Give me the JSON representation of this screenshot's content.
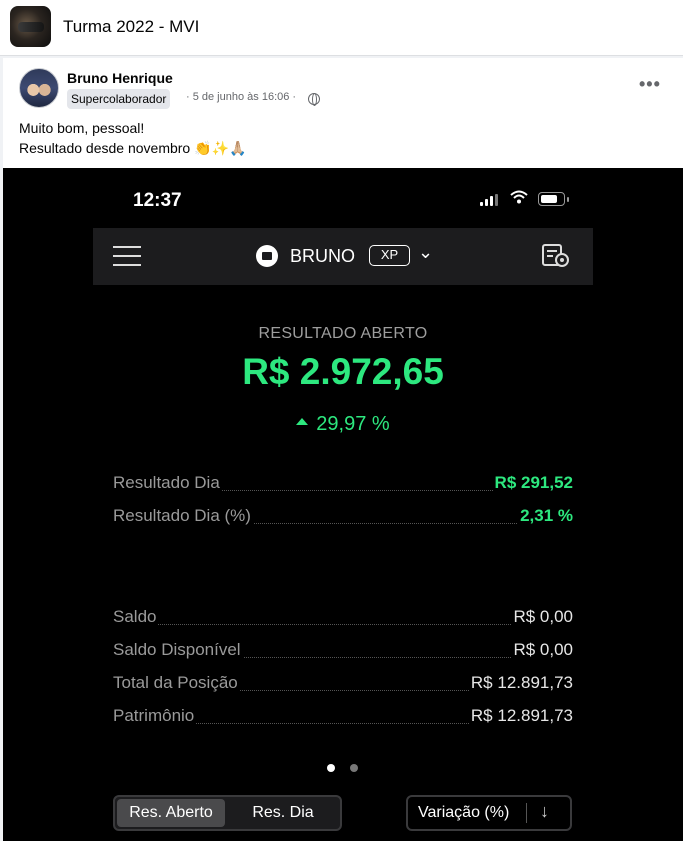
{
  "group": {
    "title": "Turma 2022 - MVI"
  },
  "post": {
    "author": "Bruno Henrique",
    "badge": "Supercolaborador",
    "meta": "· 5 de junho às 16:06 ·",
    "more": "•••",
    "message_line1": "Muito bom, pessoal!",
    "message_line2": "Resultado desde novembro 👏✨🙏🏼"
  },
  "phone": {
    "status_time": "12:37",
    "wifi_glyph": "◠",
    "account_name": "BRUNO",
    "broker": "XP",
    "chevron": "⌄",
    "result_label": "RESULTADO ABERTO",
    "result_value": "R$ 2.972,65",
    "result_pct": "29,97 %",
    "rows_top": [
      {
        "label": "Resultado Dia",
        "value": "R$ 291,52"
      },
      {
        "label": "Resultado Dia (%)",
        "value": "2,31 %"
      }
    ],
    "rows_bottom": [
      {
        "label": "Saldo",
        "value": "R$ 0,00"
      },
      {
        "label": "Saldo Disponível",
        "value": "R$ 0,00"
      },
      {
        "label": "Total da Posição",
        "value": "R$ 12.891,73"
      },
      {
        "label": "Patrimônio",
        "value": "R$ 12.891,73"
      }
    ],
    "segment": {
      "a": "Res. Aberto",
      "b": "Res. Dia"
    },
    "sort": {
      "label": "Variação (%)",
      "arrow": "↓"
    },
    "colors": {
      "positive": "#2de87f",
      "muted": "#9e9e9e"
    },
    "pager": {
      "pages": 2,
      "active": 1
    }
  }
}
